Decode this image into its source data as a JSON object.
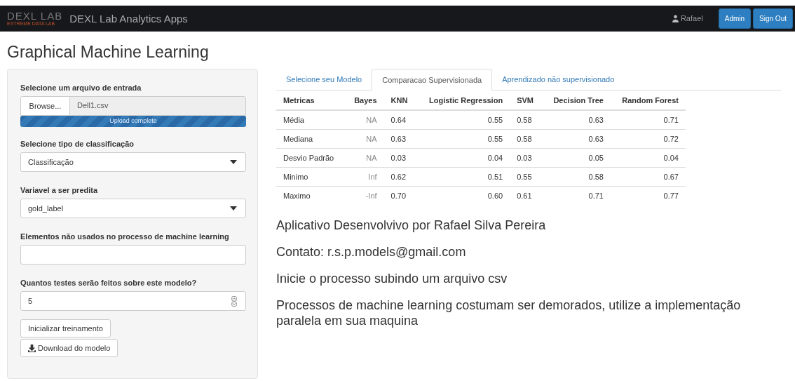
{
  "navbar": {
    "logo_main": "DEXL LAB",
    "logo_sub": "EXTREME DATA LAB",
    "title": "DEXL Lab Analytics Apps",
    "user": "Rafael",
    "buttons": [
      "Admin",
      "Sign Out"
    ]
  },
  "page_title": "Graphical Machine Learning",
  "sidebar": {
    "file_input": {
      "label": "Selecione um arquivo de entrada",
      "button": "Browse...",
      "value": "Dell1.csv",
      "progress": {
        "level": 1,
        "text": "Upload complete"
      }
    },
    "fields": [
      {
        "kind": "select",
        "label": "Selecione tipo de classificação",
        "value": "Classificação"
      },
      {
        "kind": "select",
        "label": "Variavel a ser predita",
        "value": "gold_label"
      },
      {
        "kind": "text",
        "label": "Elementos não usados no processo de machine learning"
      },
      {
        "kind": "number",
        "label": "Quantos testes serão feitos sobre este modelo?",
        "value": "5"
      }
    ],
    "buttons": [
      {
        "kind": "plain",
        "label": "Inicializar treinamento"
      },
      {
        "kind": "download",
        "label": "Download do modelo"
      }
    ]
  },
  "tabs": [
    {
      "label": "Selecione seu Modelo",
      "selected": false
    },
    {
      "label": "Comparacao Supervisionada",
      "selected": true
    },
    {
      "label": "Aprendizado não supervisionado",
      "selected": false
    }
  ],
  "table": {
    "columns": [
      "Metricas",
      "Bayes",
      "KNN",
      "Logistic Regression",
      "SVM",
      "Decision Tree",
      "Random Forest"
    ],
    "rows": [
      [
        "Média",
        "NA",
        "0.64",
        "0.55",
        "0.58",
        "0.63",
        "0.71"
      ],
      [
        "Mediana",
        "NA",
        "0.63",
        "0.55",
        "0.58",
        "0.63",
        "0.72"
      ],
      [
        "Desvio Padrão",
        "NA",
        "0.03",
        "0.04",
        "0.03",
        "0.05",
        "0.04"
      ],
      [
        "Minimo",
        "Inf",
        "0.62",
        "0.51",
        "0.55",
        "0.58",
        "0.67"
      ],
      [
        "Maximo",
        "-Inf",
        "0.70",
        "0.60",
        "0.61",
        "0.71",
        "0.77"
      ]
    ]
  },
  "paragraphs": [
    "Aplicativo Desenvolvivo por Rafael Silva Pereira",
    "Contato: r.s.p.models@gmail.com",
    "Inicie o processo subindo um arquivo csv",
    "Processos de machine learning costumam ser demorados, utilize a implementação paralela em sua maquina"
  ]
}
